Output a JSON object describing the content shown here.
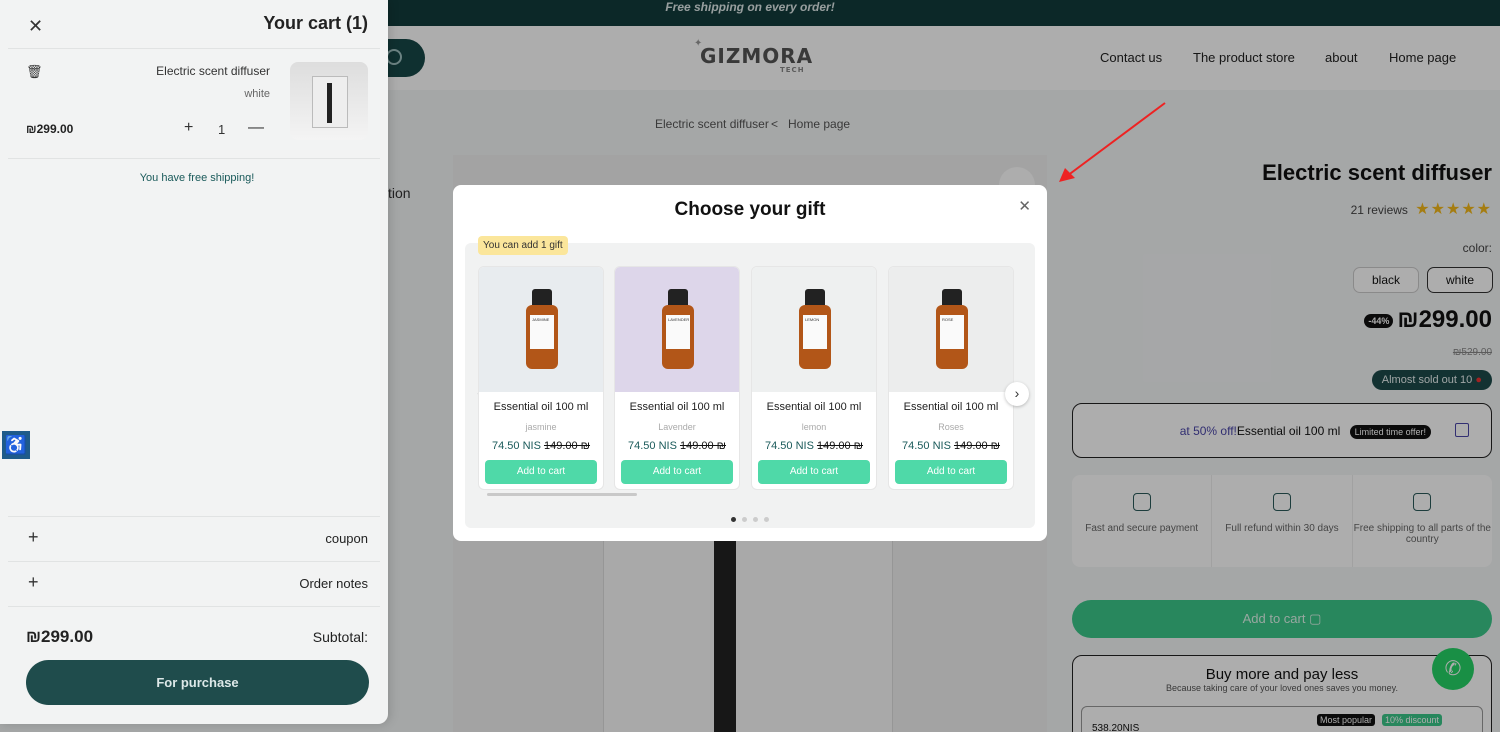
{
  "topbar": {
    "text": "Free shipping on every order!"
  },
  "header": {
    "logo": "GIZMORA",
    "logo_sub": "TECH",
    "nav": [
      "Contact us",
      "The product store",
      "about",
      "Home page"
    ]
  },
  "breadcrumb": {
    "current": "Electric scent diffuser",
    "separator": "<",
    "home": "Home page"
  },
  "product": {
    "title": "Electric scent diffuser",
    "reviews": "21 reviews",
    "stars": "★★★★★",
    "color_label": "color:",
    "variants": [
      "black",
      "white"
    ],
    "selected_variant": "white",
    "discount_badge": "-44%",
    "price": "₪299.00",
    "old_price": "₪529.00",
    "stock_text": "Almost sold out",
    "stock_count": "10",
    "offer_highlight": "at 50% off!",
    "offer_item": "Essential oil 100 ml",
    "offer_badge": "Limited time offer!",
    "features": [
      "Fast and secure payment",
      "Full refund within 30 days",
      "Free shipping to all parts of the country"
    ],
    "add_to_cart": "Add to cart",
    "buymore_title": "Buy more and pay less",
    "buymore_sub": "Because taking care of your loved ones saves you money.",
    "buymore_price": "538.20NIS",
    "badge_popular": "Most popular",
    "badge_discount": "10% discount",
    "left_tab_fragment": "tion"
  },
  "cart": {
    "title": "Your cart (1)",
    "item_name": "Electric scent diffuser",
    "item_variant": "white",
    "item_price": "₪299.00",
    "qty": "1",
    "free_shipping": "You have free shipping!",
    "coupon": "coupon",
    "order_notes": "Order notes",
    "subtotal_value": "₪299.00",
    "subtotal_label": "Subtotal:",
    "purchase": "For purchase"
  },
  "gift_modal": {
    "title": "Choose your gift",
    "tag": "You can add 1 gift",
    "cards": [
      {
        "name": "Essential oil 100 ml",
        "scent": "jasmine",
        "price": "74.50 NIS",
        "old": "149.00 ₪",
        "button": "Add to cart",
        "label": "JASMINE",
        "bg": "#e8ecef"
      },
      {
        "name": "Essential oil 100 ml",
        "scent": "Lavender",
        "price": "74.50 NIS",
        "old": "149.00 ₪",
        "button": "Add to cart",
        "label": "LAVENDER",
        "bg": "#ddd6ea"
      },
      {
        "name": "Essential oil 100 ml",
        "scent": "lemon",
        "price": "74.50 NIS",
        "old": "149.00 ₪",
        "button": "Add to cart",
        "label": "LEMON",
        "bg": "#eef0f0"
      },
      {
        "name": "Essential oil 100 ml",
        "scent": "Roses",
        "price": "74.50 NIS",
        "old": "149.00 ₪",
        "button": "Add to cart",
        "label": "ROSE",
        "bg": "#eceded"
      }
    ],
    "dots": 4,
    "active_dot": 0
  },
  "colors": {
    "brand_dark": "#1f4c4c",
    "accent_green": "#4fd9a8",
    "topbar": "#123c3c"
  }
}
